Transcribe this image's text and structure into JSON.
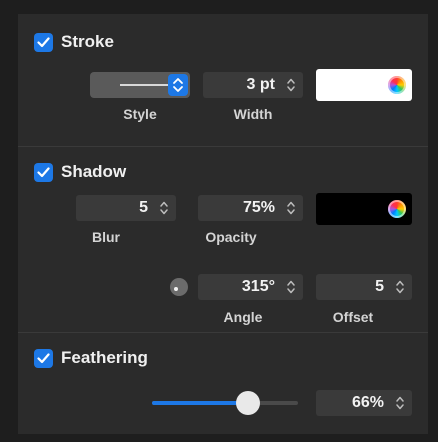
{
  "stroke": {
    "title": "Stroke",
    "checked": true,
    "style_label": "Style",
    "width_value": "3 pt",
    "width_label": "Width",
    "color": "#ffffff"
  },
  "shadow": {
    "title": "Shadow",
    "checked": true,
    "blur_value": "5",
    "blur_label": "Blur",
    "opacity_value": "75%",
    "opacity_label": "Opacity",
    "color": "#000000",
    "angle_value": "315°",
    "angle_label": "Angle",
    "offset_value": "5",
    "offset_label": "Offset"
  },
  "feathering": {
    "title": "Feathering",
    "checked": true,
    "slider_fraction": 0.66,
    "value": "66%"
  },
  "colors": {
    "accent": "#1d78e6",
    "panel_bg": "#2b2b2b"
  },
  "icons": [
    "checkmark-icon",
    "stepper-icon",
    "chevron-updown-icon",
    "color-wheel-icon"
  ]
}
